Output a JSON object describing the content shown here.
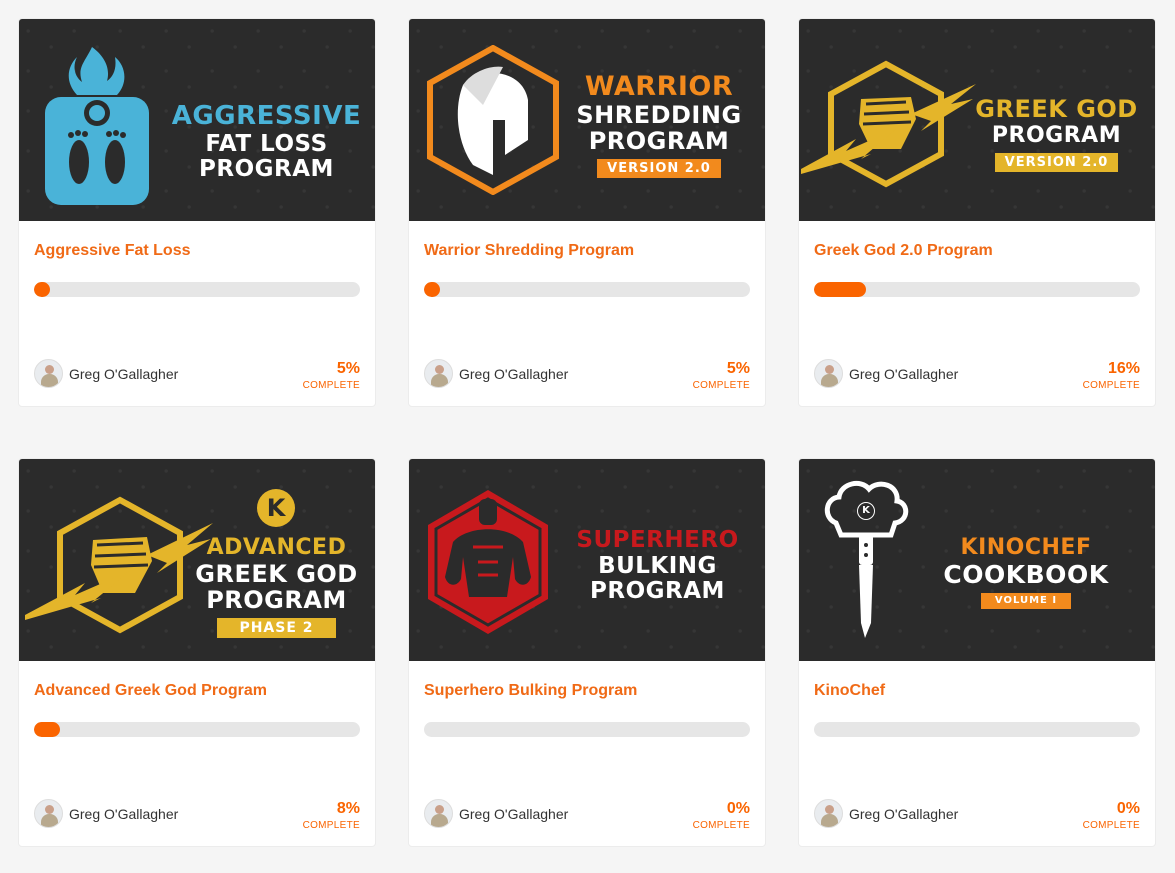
{
  "author": {
    "name": "Greg O'Gallagher"
  },
  "complete_label": "COMPLETE",
  "colors": {
    "accent": "#fa6400",
    "title": "#f06a16",
    "cover_bg": "#2b2b2b",
    "blue": "#4ab3d8",
    "orange": "#f28a1d",
    "gold": "#e4b52a",
    "red": "#c8191d"
  },
  "courses": [
    {
      "title": "Aggressive Fat Loss",
      "progress": 5,
      "progress_text": "5%",
      "cover": {
        "lines": [
          "AGGRESSIVE",
          "FAT LOSS",
          "PROGRAM"
        ],
        "badge": "",
        "icon": "scale-flame-icon"
      }
    },
    {
      "title": "Warrior Shredding Program",
      "progress": 5,
      "progress_text": "5%",
      "cover": {
        "lines": [
          "WARRIOR",
          "SHREDDING",
          "PROGRAM"
        ],
        "badge": "VERSION 2.0",
        "icon": "spartan-helmet-icon"
      }
    },
    {
      "title": "Greek God 2.0 Program",
      "progress": 16,
      "progress_text": "16%",
      "cover": {
        "lines": [
          "GREEK GOD",
          "PROGRAM"
        ],
        "badge": "VERSION 2.0",
        "icon": "lightning-fist-icon"
      }
    },
    {
      "title": "Advanced Greek God Program",
      "progress": 8,
      "progress_text": "8%",
      "cover": {
        "lines": [
          "ADVANCED",
          "GREEK GOD",
          "PROGRAM"
        ],
        "badge": "PHASE 2",
        "logo": "K",
        "icon": "lightning-fist-icon"
      }
    },
    {
      "title": "Superhero Bulking Program",
      "progress": 0,
      "progress_text": "0%",
      "cover": {
        "lines": [
          "SUPERHERO",
          "BULKING",
          "PROGRAM"
        ],
        "badge": "",
        "icon": "superhero-torso-icon"
      }
    },
    {
      "title": "KinoChef",
      "progress": 0,
      "progress_text": "0%",
      "cover": {
        "lines": [
          "KINOCHEF",
          "COOKBOOK"
        ],
        "badge": "VOLUME I",
        "logo": "K",
        "icon": "chef-knife-icon"
      }
    }
  ]
}
